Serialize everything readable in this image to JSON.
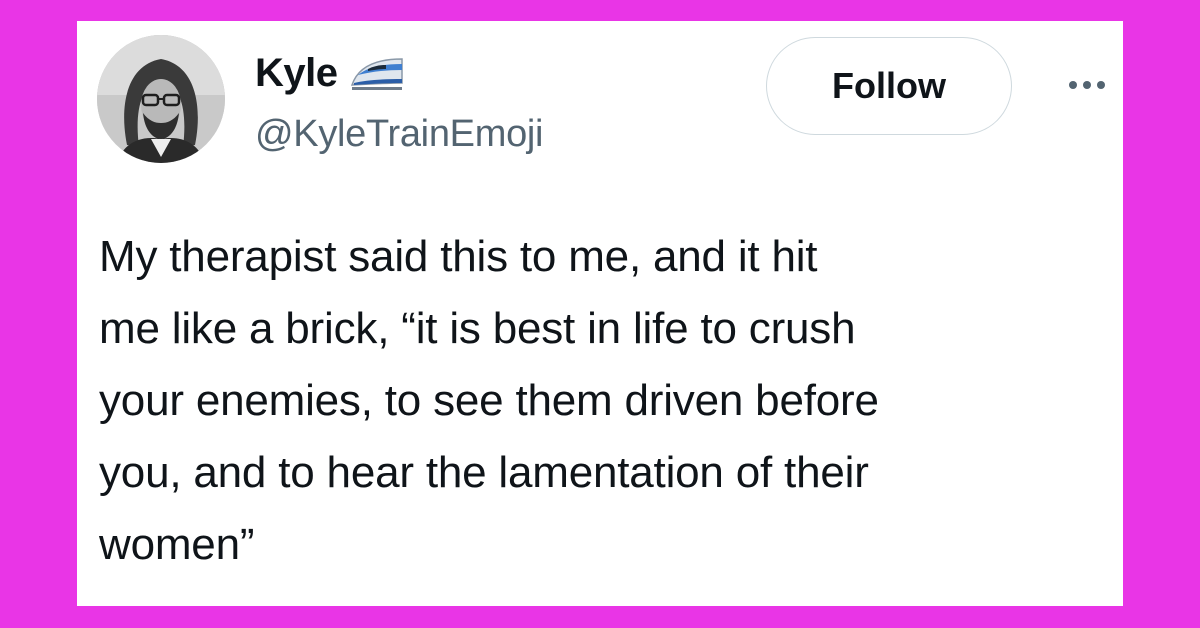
{
  "author": {
    "display_name": "Kyle",
    "handle": "@KyleTrainEmoji",
    "name_emoji": "high-speed-train-emoji"
  },
  "actions": {
    "follow_label": "Follow",
    "more_icon": "more-horizontal-icon"
  },
  "tweet": {
    "text": "My therapist said this to me, and it hit\nme like a brick, “it is best in life to crush\nyour enemies, to see them driven before\nyou, and to hear the lamentation of their\nwomen”"
  },
  "colors": {
    "background": "#e935e6",
    "card": "#ffffff",
    "text_primary": "#0f1419",
    "text_secondary": "#536471",
    "button_border": "#cfd9de"
  }
}
